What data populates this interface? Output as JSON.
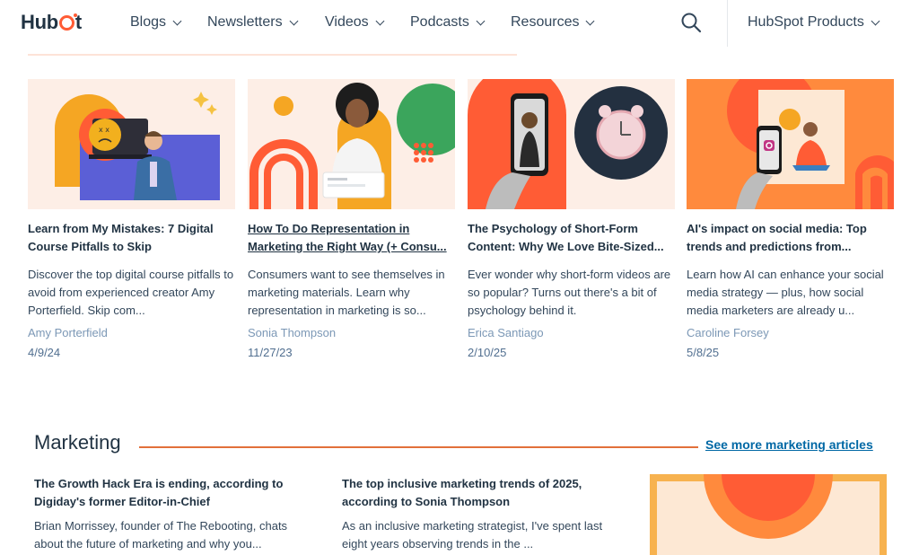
{
  "nav": {
    "logo_text": "HubSpot",
    "items": [
      {
        "label": "Blogs"
      },
      {
        "label": "Newsletters"
      },
      {
        "label": "Videos"
      },
      {
        "label": "Podcasts"
      },
      {
        "label": "Resources"
      }
    ],
    "products_label": "HubSpot Products"
  },
  "cards": [
    {
      "title": "Learn from My Mistakes: 7 Digital Course Pitfalls to Skip",
      "desc": "Discover the top digital course pitfalls to avoid from experienced creator Amy Porterfield. Skip com...",
      "author": "Amy Porterfield",
      "date": "4/9/24"
    },
    {
      "title": "How To Do Representation in Marketing the Right Way (+ Consu...",
      "desc": "Consumers want to see themselves in marketing materials. Learn why representation in marketing is so...",
      "author": "Sonia Thompson",
      "date": "11/27/23"
    },
    {
      "title": "The Psychology of Short-Form Content: Why We Love Bite-Sized...",
      "desc": "Ever wonder why short-form videos are so popular? Turns out there's a bit of psychology behind it.",
      "author": "Erica Santiago",
      "date": "2/10/25"
    },
    {
      "title": "AI's impact on social media: Top trends and predictions from...",
      "desc": "Learn how AI can enhance your social media strategy — plus, how social media marketers are already u...",
      "author": "Caroline Forsey",
      "date": "5/8/25"
    }
  ],
  "marketing": {
    "title": "Marketing",
    "see_more": "See more marketing articles",
    "articles": [
      {
        "title": "The Growth Hack Era is ending, according to Digiday's former Editor-in-Chief",
        "desc": "Brian Morrissey, founder of The Rebooting, chats about the future of marketing and why you..."
      },
      {
        "title": "The top inclusive marketing trends of 2025, according to Sonia Thompson",
        "desc": "As an inclusive marketing strategist, I've spent last eight years observing trends in the ..."
      }
    ]
  },
  "colors": {
    "brand": "#ff5c35",
    "accent_line": "#e2703a",
    "link": "#0068a5",
    "text_dark": "#213343",
    "text_muted": "#7c98b6"
  },
  "icons": {
    "search": "search-icon",
    "chevron": "chevron-down-icon"
  }
}
